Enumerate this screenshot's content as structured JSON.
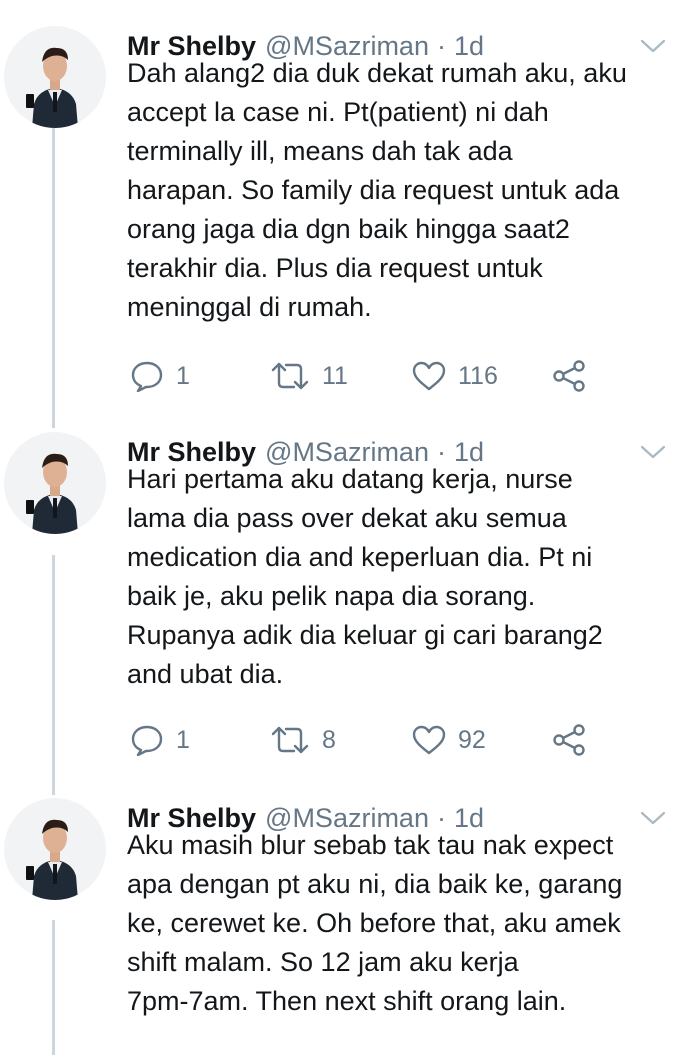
{
  "colors": {
    "text": "#14171a",
    "secondary": "#657786",
    "thread_line": "#ccd6dd",
    "background": "#ffffff"
  },
  "icons": {
    "reply": "speech-bubble-icon",
    "retweet": "retweet-arrows-icon",
    "like": "heart-icon",
    "share": "share-nodes-icon",
    "more": "chevron-down-icon"
  },
  "tweets": [
    {
      "name": "Mr Shelby",
      "handle": "@MSazriman",
      "separator": "·",
      "time": "1d",
      "text": "Dah alang2 dia duk dekat rumah aku, aku\naccept la case ni.  Pt(patient) ni dah\nterminally ill, means dah tak ada\nharapan. So family dia request untuk ada\norang jaga dia dgn baik hingga saat2\nterakhir dia. Plus dia request untuk\nmeninggal di rumah.",
      "replies": "1",
      "retweets": "11",
      "likes": "116"
    },
    {
      "name": "Mr Shelby",
      "handle": "@MSazriman",
      "separator": "·",
      "time": "1d",
      "text": "Hari pertama aku datang kerja, nurse\nlama dia pass over dekat aku semua\nmedication dia and keperluan dia. Pt ni\nbaik je, aku pelik napa dia sorang.\nRupanya adik dia keluar gi cari barang2\nand ubat dia.",
      "replies": "1",
      "retweets": "8",
      "likes": "92"
    },
    {
      "name": "Mr Shelby",
      "handle": "@MSazriman",
      "separator": "·",
      "time": "1d",
      "text": "Aku masih blur sebab tak tau nak expect\napa dengan pt aku ni, dia baik ke, garang\nke, cerewet ke. Oh before that, aku amek\nshift malam. So 12 jam aku kerja\n7pm-7am. Then next shift orang lain."
    }
  ]
}
